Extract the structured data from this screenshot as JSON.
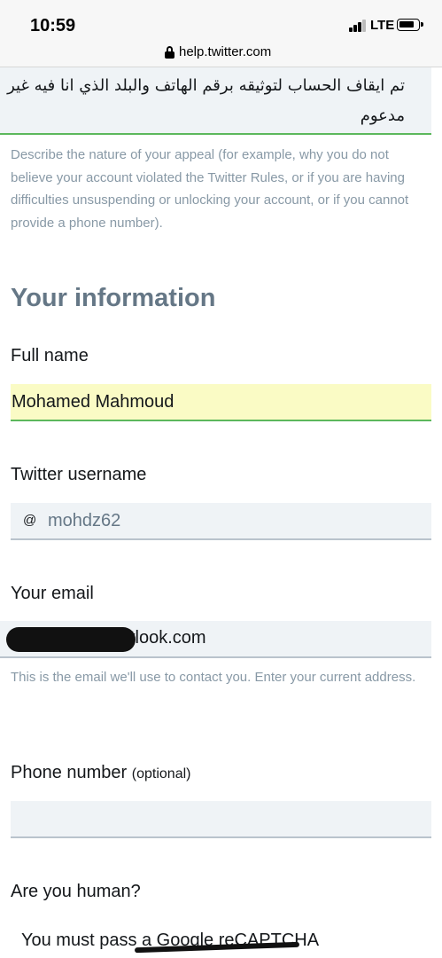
{
  "status_bar": {
    "time": "10:59",
    "network": "LTE"
  },
  "browser": {
    "url": "help.twitter.com"
  },
  "appeal": {
    "value": "تم ايقاف الحساب لتوثيقه برقم الهاتف والبلد الذي انا فيه غير مدعوم",
    "help": "Describe the nature of your appeal (for example, why you do not believe your account violated the Twitter Rules, or if you are having difficulties unsuspending or unlocking your account, or if you cannot provide a phone number)."
  },
  "section_title": "Your information",
  "full_name": {
    "label": "Full name",
    "value": "Mohamed Mahmoud"
  },
  "twitter_username": {
    "label": "Twitter username",
    "prefix": "@",
    "value": "mohdz62"
  },
  "email": {
    "label": "Your email",
    "visible_suffix": "tlook.com",
    "help": "This is the email we'll use to contact you. Enter your current address."
  },
  "phone": {
    "label": "Phone number",
    "optional": "(optional)",
    "value": ""
  },
  "human": {
    "label": "Are you human?",
    "captcha_text": "You must pass a Google reCAPTCHA"
  }
}
